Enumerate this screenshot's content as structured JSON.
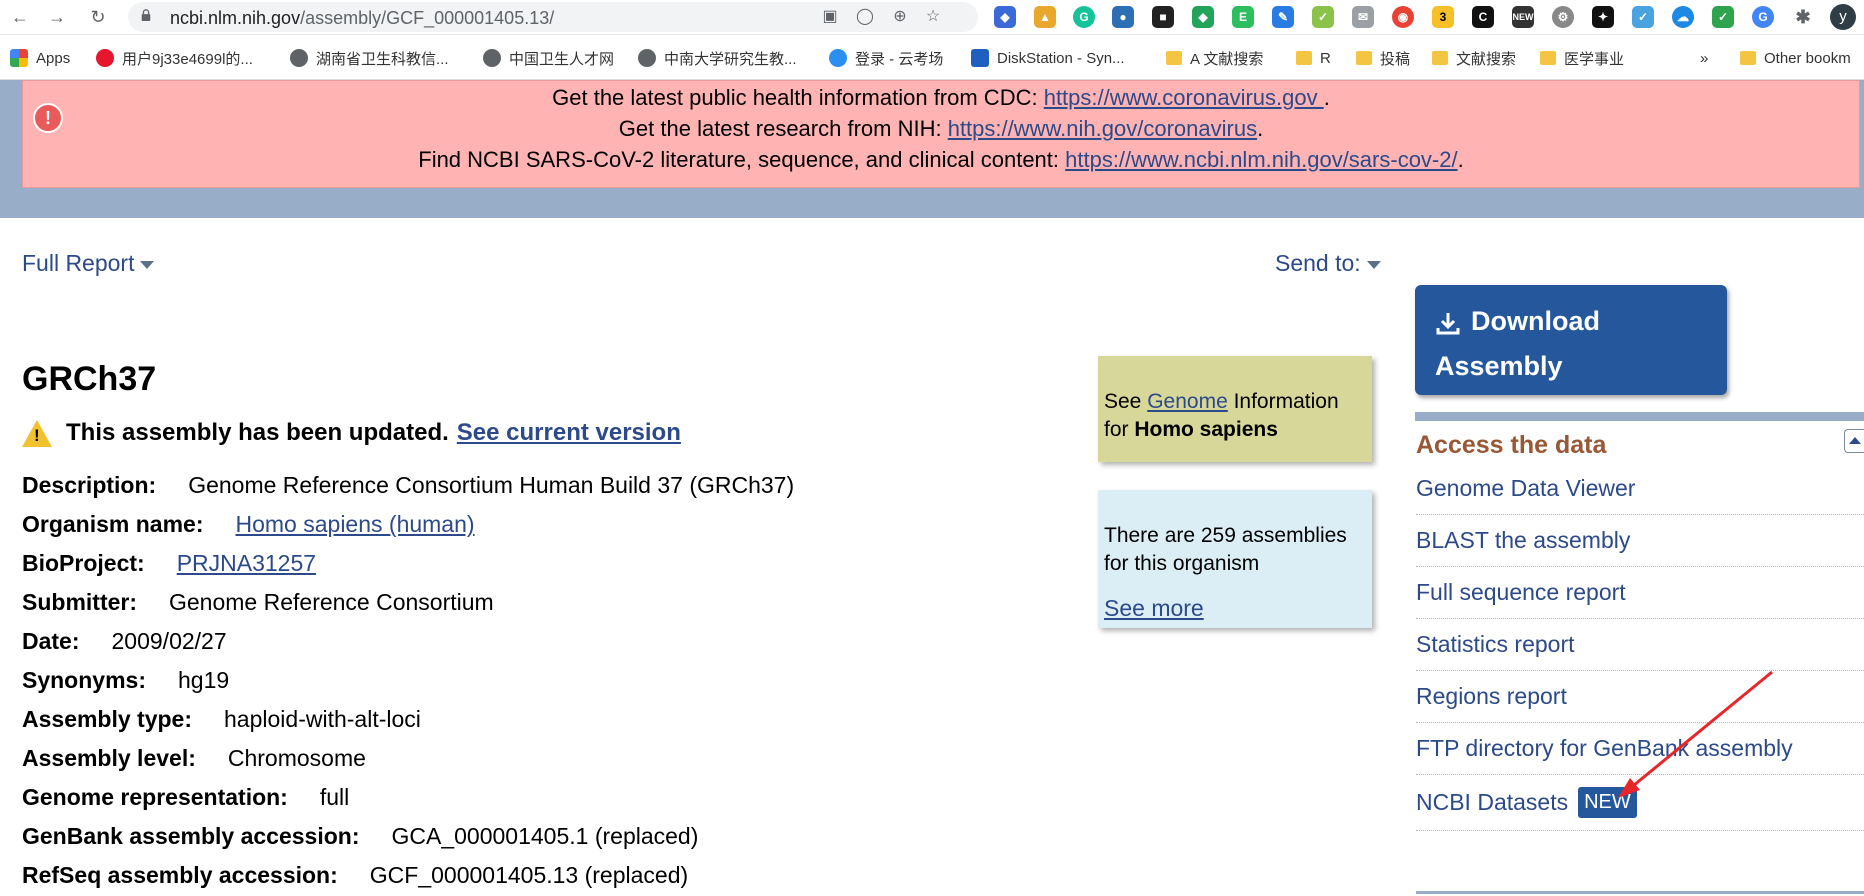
{
  "browser": {
    "url_host": "ncbi.nlm.nih.gov",
    "url_path": "/assembly/GCF_000001405.13/",
    "extension_badge": "3",
    "extension_new_label": "NEW",
    "profile_initial": "y"
  },
  "bookmarks": {
    "items": [
      "Apps",
      "用户9j33e4699l的...",
      "湖南省卫生科教信...",
      "中国卫生人才网",
      "中南大学研究生教...",
      "登录 - 云考场",
      "DiskStation - Syn...",
      "A 文献搜索",
      "R",
      "投稿",
      "文献搜索",
      "医学事业"
    ],
    "overflow": "»",
    "other": "Other bookm"
  },
  "alert": {
    "line1_text": "Get the latest public health information from CDC: ",
    "line1_link": "https://www.coronavirus.gov ",
    "line2_text": "Get the latest research from NIH: ",
    "line2_link": "https://www.nih.gov/coronavirus",
    "line3_text": "Find NCBI SARS-CoV-2 literature, sequence, and clinical content: ",
    "line3_link": "https://www.ncbi.nlm.nih.gov/sars-cov-2/",
    "period": "."
  },
  "report": {
    "format_label": "Full Report",
    "send_to_label": "Send to:"
  },
  "assembly": {
    "title": "GRCh37",
    "updated_text": "This assembly has been updated.",
    "current_version_link": "See current version",
    "fields": [
      {
        "key": "Description:",
        "value": "Genome Reference Consortium Human Build 37 (GRCh37)"
      },
      {
        "key": "Organism name:",
        "value": "Homo sapiens (human)"
      },
      {
        "key": "BioProject:",
        "value": "PRJNA31257"
      },
      {
        "key": "Submitter:",
        "value": "Genome Reference Consortium"
      },
      {
        "key": "Date:",
        "value": "2009/02/27"
      },
      {
        "key": "Synonyms:",
        "value": "hg19"
      },
      {
        "key": "Assembly type:",
        "value": "haploid-with-alt-loci"
      },
      {
        "key": "Assembly level:",
        "value": "Chromosome"
      },
      {
        "key": "Genome representation:",
        "value": "full"
      },
      {
        "key": "GenBank assembly accession:",
        "value": "GCA_000001405.1 (replaced)"
      },
      {
        "key": "RefSeq assembly accession:",
        "value": "GCF_000001405.13 (replaced)"
      }
    ]
  },
  "genome_box": {
    "prefix": "See ",
    "link": "Genome",
    "suffix": " Information",
    "line2_prefix": "for ",
    "organism": "Homo sapiens"
  },
  "assemblies_box": {
    "text": "There are 259 assemblies for this organism",
    "link": "See more"
  },
  "sidebar": {
    "download_line1": "Download",
    "download_line2": "Assembly",
    "section_title": "Access the data",
    "links": [
      "Genome Data Viewer",
      "BLAST the assembly",
      "Full sequence report",
      "Statistics report",
      "Regions report",
      "FTP directory for GenBank assembly",
      "NCBI Datasets"
    ],
    "new_badge": "NEW"
  },
  "colors": {
    "link": "#2c4a8a",
    "alert_bg": "#ffb3b3",
    "banner_blue": "#97adc8",
    "download_bg": "#24579c",
    "section_title": "#985735",
    "annotation_arrow": "#e8262a"
  }
}
